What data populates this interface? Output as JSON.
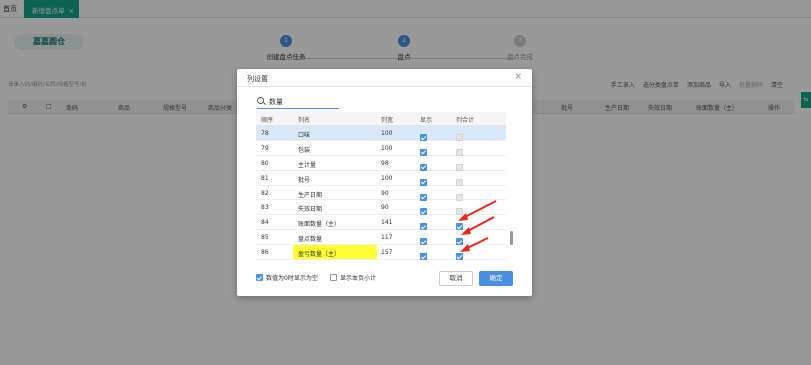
{
  "tabs": {
    "home": "首页",
    "active": "新增盘点单",
    "active_close": "×"
  },
  "page": {
    "warehouse": "嘉嘉圆仓",
    "steps": [
      {
        "num": "1",
        "label": "创建盘点任务"
      },
      {
        "num": "2",
        "label": "盘点"
      },
      {
        "num": "3",
        "label": "盘点完成"
      }
    ],
    "search_hint": "请录入码/编码/名称/规格型号/批",
    "toolbar_buttons": [
      "手工录入",
      "选分类盘点单",
      "添加商品",
      "导入",
      "批量删除",
      "清空"
    ],
    "columns_left": [
      "条码",
      "商品",
      "规格型号",
      "商品分类"
    ],
    "columns_right": [
      "批号",
      "生产日期",
      "失效日期",
      "账面数量（主）",
      "操作"
    ]
  },
  "dialog": {
    "title": "列设置",
    "close": "×",
    "search_value": "数量",
    "headers": {
      "no": "顺序",
      "name": "列名",
      "width": "列宽",
      "show": "显示",
      "sum": "列合计"
    },
    "rows": [
      {
        "no": "78",
        "name": "口味",
        "width": "100",
        "show": true,
        "sum": "disabled",
        "selected": true
      },
      {
        "no": "79",
        "name": "包装",
        "width": "100",
        "show": true,
        "sum": "disabled"
      },
      {
        "no": "80",
        "name": "主计量",
        "width": "98",
        "show": true,
        "sum": "disabled"
      },
      {
        "no": "81",
        "name": "批号",
        "width": "100",
        "show": true,
        "sum": "disabled"
      },
      {
        "no": "82",
        "name": "生产日期",
        "width": "90",
        "show": true,
        "sum": "disabled"
      },
      {
        "no": "83",
        "name": "失效日期",
        "width": "90",
        "show": true,
        "sum": "disabled"
      },
      {
        "no": "84",
        "name": "账面数量（主）",
        "width": "141",
        "show": true,
        "sum": "checked"
      },
      {
        "no": "85",
        "name": "盘点数量",
        "width": "117",
        "show": true,
        "sum": "checked"
      },
      {
        "no": "86",
        "name": "盈亏数量（主）",
        "width": "157",
        "show": true,
        "sum": "checked",
        "highlight": true
      }
    ],
    "option_zero_blank": "数值为0时显示为空",
    "option_page_subtotal": "显示本页小计",
    "cancel": "取消",
    "ok": "确定"
  },
  "colors": {
    "accent": "#17a589",
    "primary": "#4a90e2",
    "highlight": "#ffff33",
    "arrow": "#e8281e"
  }
}
